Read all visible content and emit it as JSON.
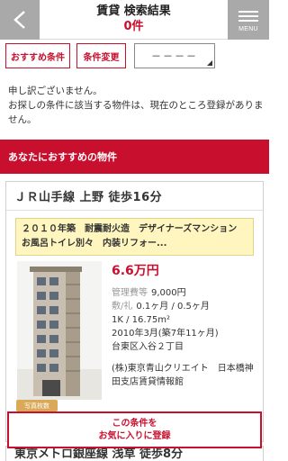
{
  "header": {
    "title": "賃貸 検索結果",
    "count": "0件",
    "menu_label": "MENU"
  },
  "toolbar": {
    "recommended_label": "おすすめ条件",
    "change_label": "条件変更",
    "sort_value": "－－－－"
  },
  "message": {
    "line1": "申し訳ございません。",
    "line2": "お探しの条件に該当する物件は、現在のところ登録がありません。"
  },
  "section": {
    "title": "あなたにおすすめの物件"
  },
  "listing": {
    "station": "ＪＲ山手線 上野 徒歩16分",
    "catch": "２０１０年築　耐震耐火造　デザイナーズマンション　お風呂トイレ別々　内装リフォー...",
    "price": "6.6万円",
    "fee_label": "管理費等",
    "fee_value": "9,000円",
    "deposit_label": "敷/礼",
    "deposit_value": "0.1ヶ月 / 0.5ヶ月",
    "layout": "1K / 16.75m²",
    "built": "2010年3月(築7年11ヶ月)",
    "address": "台東区入谷２丁目",
    "company": "(株)東京青山クリエイト　日本橋神田支店賃貸情報館",
    "photo_badge": "写真枚数"
  },
  "favorite": {
    "line1": "この条件を",
    "line2": "お気に入りに登録"
  },
  "next_listing": {
    "station": "東京メトロ銀座線 浅草 徒歩8分"
  }
}
